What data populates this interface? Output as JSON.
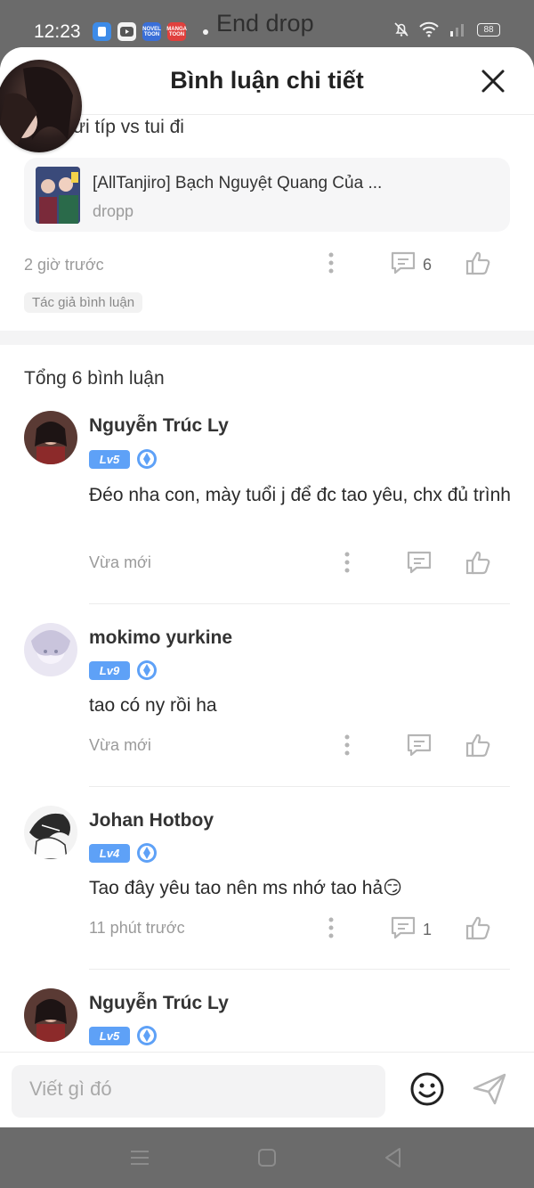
{
  "status_bar": {
    "time": "12:23",
    "app_icons": [
      {
        "name": "files-app-icon",
        "label": "",
        "color": "#3d8be8"
      },
      {
        "name": "youtube-icon",
        "label": "",
        "color": "#f2f2f2"
      },
      {
        "name": "novel-toon-icon",
        "label": "NOVEL TOON",
        "color": "#3a6fd8"
      },
      {
        "name": "manga-toon-icon",
        "label": "MANGA TOON",
        "color": "#e0403d"
      }
    ],
    "background_text": "End drop",
    "battery": "88"
  },
  "header": {
    "title": "Bình luận chi tiết"
  },
  "original_comment": {
    "text_fragment": "ửi típ vs tui đi",
    "work": {
      "title": "[AllTanjiro] Bạch Nguyệt Quang Của ...",
      "subtitle": "dropp"
    },
    "time": "2 giờ trước",
    "reply_count": "6",
    "author_tag": "Tác giả bình luận"
  },
  "total_label": "Tổng 6 bình luận",
  "comments": [
    {
      "name": "Nguyễn Trúc Ly",
      "level": "Lv5",
      "text": "Đéo nha con, mày tuổi j để đc tao yêu, chx đủ trình",
      "time": "Vừa mới",
      "reply_count": ""
    },
    {
      "name": "mokimo yurkine",
      "level": "Lv9",
      "text": "tao có ny rồi ha",
      "time": "Vừa mới",
      "reply_count": ""
    },
    {
      "name": "Johan Hotboy",
      "level": "Lv4",
      "text": "Tao đây yêu tao nên ms nhớ tao hả😏",
      "time": "11 phút trước",
      "reply_count": "1"
    },
    {
      "name": "Nguyễn Trúc Ly",
      "level": "Lv5",
      "text": "",
      "time": "",
      "reply_count": ""
    }
  ],
  "input": {
    "placeholder": "Viết gì đó"
  },
  "colors": {
    "level_badge": "#5ea1f7",
    "icon_gray": "#b5b5b5",
    "dim_background": "#6b6b6b"
  }
}
